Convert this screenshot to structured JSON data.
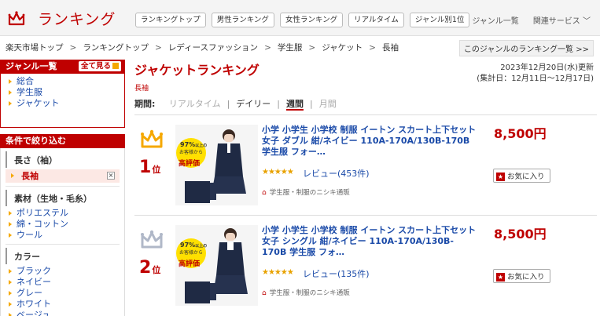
{
  "header": {
    "logo_text": "ランキング",
    "nav": [
      "ランキングトップ",
      "男性ランキング",
      "女性ランキング",
      "リアルタイム",
      "ジャンル別1位"
    ],
    "genre_list": "ジャンル一覧",
    "related": "関連サービス"
  },
  "breadcrumb": {
    "items": [
      "楽天市場トップ",
      "ランキングトップ",
      "レディースファッション",
      "学生服",
      "ジャケット",
      "長袖"
    ],
    "sep": ">",
    "right_link": "このジャンルのランキング一覧 >>"
  },
  "sidebar": {
    "genre_head": "ジャンル一覧",
    "see_all": "全て見る",
    "genres": [
      "総合",
      "学生服",
      "ジャケット"
    ],
    "cond_head": "条件で絞り込む",
    "sleeve_title": "長さ（袖）",
    "selected": "長袖",
    "material_title": "素材（生地・毛糸）",
    "materials": [
      "ポリエステル",
      "綿・コットン",
      "ウール"
    ],
    "color_title": "カラー",
    "colors": [
      "ブラック",
      "ネイビー",
      "グレー",
      "ホワイト",
      "ベージュ"
    ]
  },
  "main": {
    "title": "ジャケットランキング",
    "subtitle": "長袖",
    "date_line1": "2023年12月20日(水)更新",
    "date_line2": "(集計日：12月11日～12月17日)",
    "period_label": "期間:",
    "periods": [
      "リアルタイム",
      "デイリー",
      "週間",
      "月間"
    ]
  },
  "items": [
    {
      "rank": "1",
      "rank_suffix": "位",
      "crown_color": "#f5a800",
      "title": "小学 小学生 小学校 制服 イートン スカート上下セット 女子 ダブル 紺/ネイビー 110A-170A/130B-170B 学生服 フォー…",
      "price": "8,500円",
      "stars": "★★★★★",
      "review": "レビュー(453件)",
      "shop": "学生服・制服のニシキ通販",
      "fav": "お気に入り",
      "badge_pct": "97%",
      "badge_l1": "以上の",
      "badge_l2": "お客様から",
      "badge_l3": "高評価"
    },
    {
      "rank": "2",
      "rank_suffix": "位",
      "crown_color": "#b0b8c8",
      "title": "小学 小学生 小学校 制服 イートン スカート上下セット 女子 シングル 紺/ネイビー 110A-170A/130B-170B 学生服 フォ…",
      "price": "8,500円",
      "stars": "★★★★★",
      "review": "レビュー(135件)",
      "shop": "学生服・制服のニシキ通販",
      "fav": "お気に入り",
      "badge_pct": "97%",
      "badge_l1": "以上の",
      "badge_l2": "お客様から",
      "badge_l3": "高評価"
    }
  ]
}
